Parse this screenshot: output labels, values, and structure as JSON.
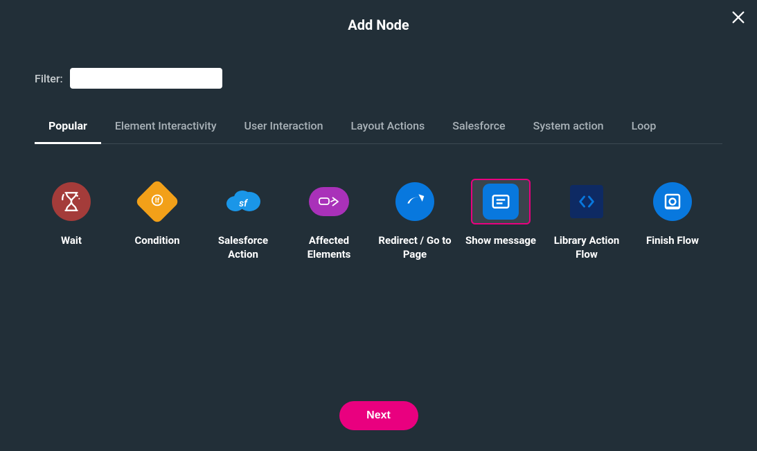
{
  "title": "Add Node",
  "filter": {
    "label": "Filter:",
    "value": ""
  },
  "tabs": [
    {
      "label": "Popular",
      "active": true
    },
    {
      "label": "Element Interactivity",
      "active": false
    },
    {
      "label": "User Interaction",
      "active": false
    },
    {
      "label": "Layout Actions",
      "active": false
    },
    {
      "label": "Salesforce",
      "active": false
    },
    {
      "label": "System action",
      "active": false
    },
    {
      "label": "Loop",
      "active": false
    }
  ],
  "nodes": [
    {
      "label": "Wait",
      "icon": "wait",
      "selected": false
    },
    {
      "label": "Condition",
      "icon": "condition",
      "selected": false
    },
    {
      "label": "Salesforce Action",
      "icon": "salesforce",
      "selected": false
    },
    {
      "label": "Affected Elements",
      "icon": "affected",
      "selected": false
    },
    {
      "label": "Redirect / Go to Page",
      "icon": "redirect",
      "selected": false
    },
    {
      "label": "Show message",
      "icon": "message",
      "selected": true
    },
    {
      "label": "Library Action Flow",
      "icon": "library",
      "selected": false
    },
    {
      "label": "Finish Flow",
      "icon": "finish",
      "selected": false
    }
  ],
  "buttons": {
    "next": "Next"
  },
  "colors": {
    "wait": "#a43c3a",
    "condition": "#f2a019",
    "salesforce": "#1a96e8",
    "affected": "#a931b9",
    "redirect": "#0878de",
    "message": "#0878de",
    "library": "#0e2a63",
    "finish": "#0878de",
    "accent": "#e9007f"
  }
}
